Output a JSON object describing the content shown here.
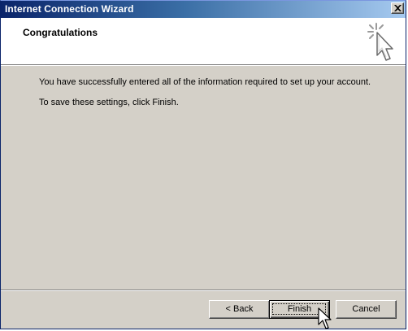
{
  "window": {
    "title": "Internet Connection Wizard"
  },
  "header": {
    "heading": "Congratulations",
    "icon": "wizard-wand-cursor-icon"
  },
  "body": {
    "line1": "You have successfully entered all of the information required to set up your account.",
    "line2": "To save these settings, click Finish."
  },
  "buttons": {
    "back_label": "< Back",
    "finish_label": "Finish",
    "cancel_label": "Cancel"
  },
  "colors": {
    "titlebar_start": "#0a246a",
    "titlebar_end": "#a6caf0",
    "dialog_bg": "#d4d0c8"
  }
}
